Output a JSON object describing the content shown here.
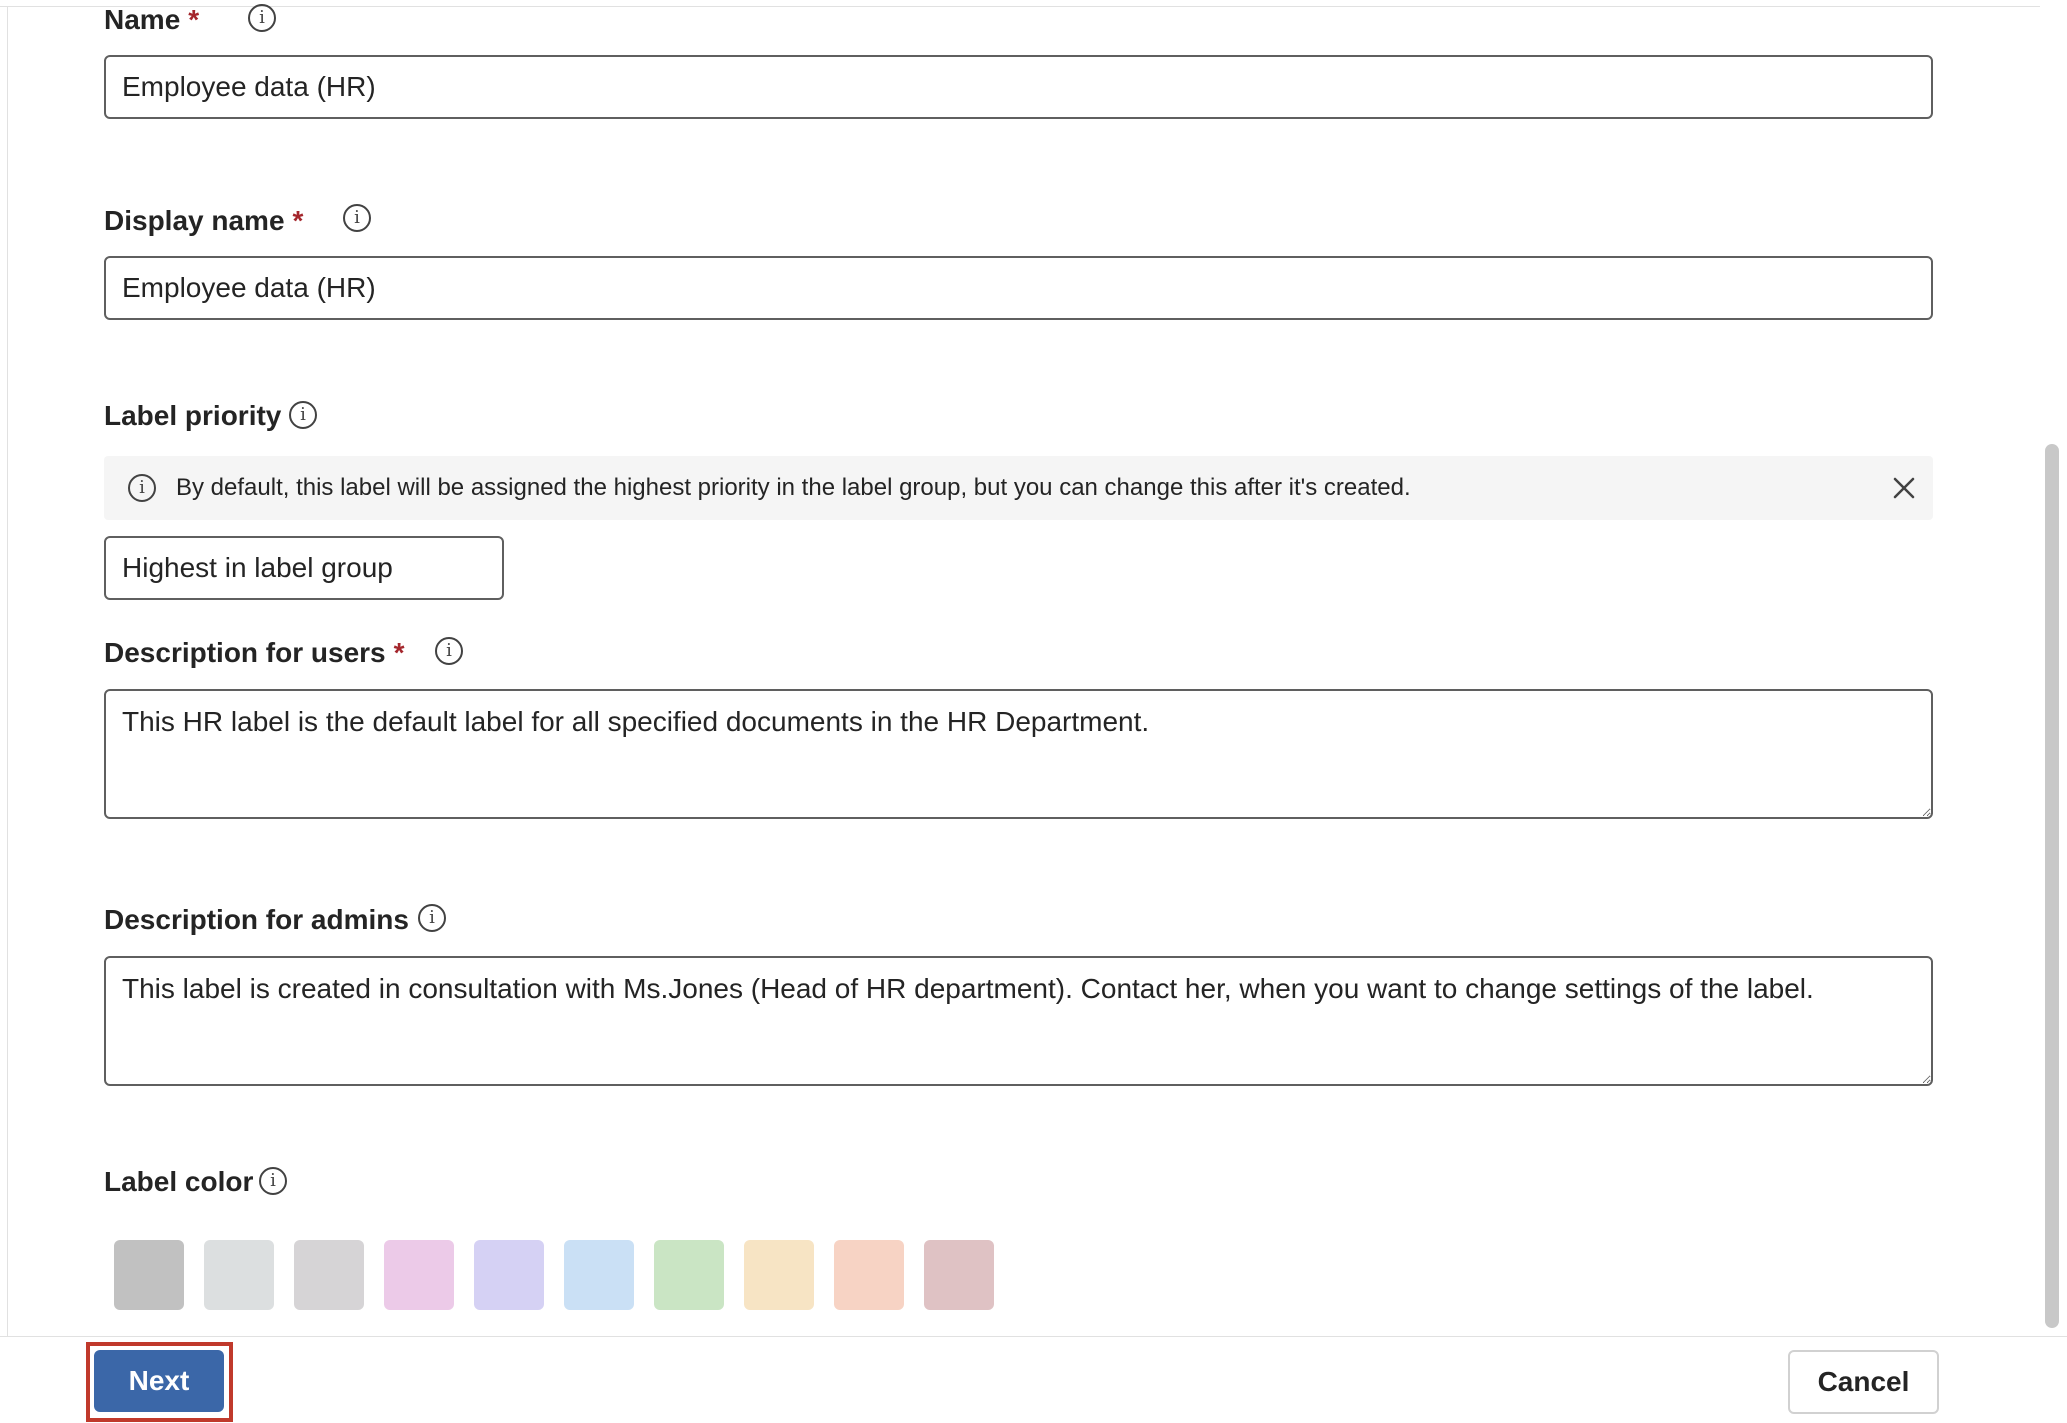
{
  "form": {
    "name": {
      "label": "Name",
      "required_mark": "*",
      "value": "Employee data (HR)"
    },
    "display_name": {
      "label": "Display name",
      "required_mark": "*",
      "value": "Employee data (HR)"
    },
    "label_priority": {
      "label": "Label priority",
      "info_message": "By default, this label will be assigned the highest priority in the label group, but you can change this after it's created.",
      "value": "Highest in label group"
    },
    "description_users": {
      "label": "Description for users",
      "required_mark": "*",
      "value": "This HR label is the default label for all specified documents in the HR Department."
    },
    "description_admins": {
      "label": "Description for admins",
      "value": "This label is created in consultation with Ms.Jones (Head of HR department). Contact her, when you want to change settings of the label."
    },
    "label_color": {
      "label": "Label color",
      "swatches": [
        "#c1c1c1",
        "#dcdfe0",
        "#d6d4d6",
        "#eccae8",
        "#d5d1f4",
        "#cae0f5",
        "#cae5c4",
        "#f7e4c4",
        "#f7d3c4",
        "#dfc2c4"
      ]
    }
  },
  "footer": {
    "next_label": "Next",
    "cancel_label": "Cancel"
  },
  "icons": {
    "info": "info-icon",
    "close": "close-icon"
  }
}
